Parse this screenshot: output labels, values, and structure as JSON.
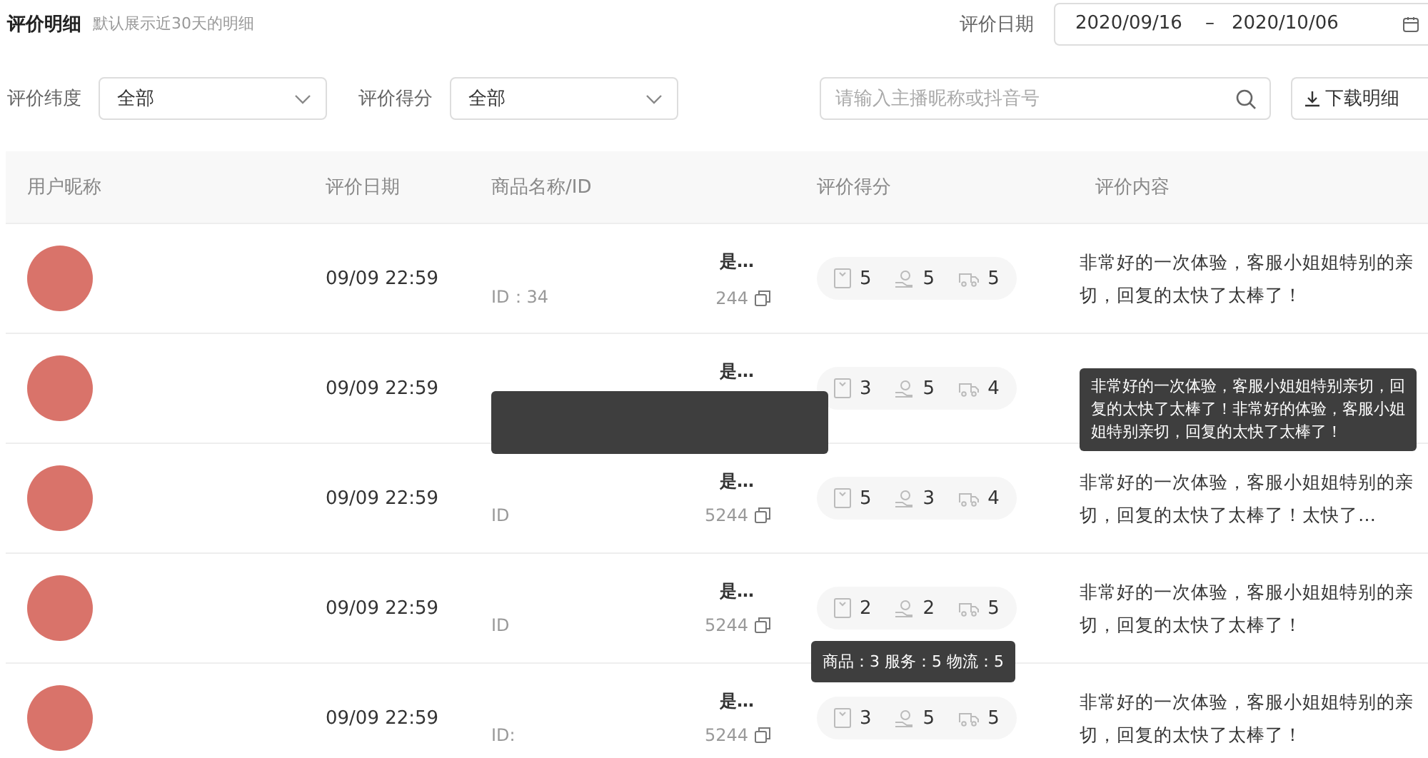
{
  "header": {
    "title": "评价明细",
    "subtitle": "默认展示近30天的明细",
    "date_label": "评价日期",
    "date_start": "2020/09/16",
    "date_separator": "–",
    "date_end": "2020/10/06"
  },
  "filters": [
    {
      "label": "评价纬度",
      "value": "全部"
    },
    {
      "label": "评价得分",
      "value": "全部"
    }
  ],
  "search": {
    "placeholder": "请输入主播昵称或抖音号"
  },
  "download_button": "下载明细",
  "table": {
    "columns": [
      "用户昵称",
      "评价日期",
      "商品名称/ID",
      "评价得分",
      "评价内容"
    ],
    "rows": [
      {
        "date": "09/09 22:59",
        "product": {
          "name": "是…",
          "id_label": "ID：34",
          "id_tail": "244"
        },
        "scores": [
          "5",
          "5",
          "5"
        ],
        "content": "非常好的一次体验，客服小姐姐特别的亲切，回复的太快了太棒了！"
      },
      {
        "date": "09/09 22:59",
        "product": {
          "name": "是…"
        },
        "product_tooltip": true,
        "scores": [
          "3",
          "5",
          "4"
        ],
        "content_tooltip": "非常好的一次体验，客服小姐姐特别亲切，回复的太快了太棒了！非常好的体验，客服小姐姐特别亲切，回复的太快了太棒了！"
      },
      {
        "date": "09/09 22:59",
        "product": {
          "name": "是…",
          "id_label": "ID",
          "id_tail": "5244"
        },
        "scores": [
          "5",
          "3",
          "4"
        ],
        "content": "非常好的一次体验，客服小姐姐特别的亲切，回复的太快了太棒了！太快了…"
      },
      {
        "date": "09/09 22:59",
        "product": {
          "name": "是…",
          "id_label": "ID",
          "id_tail": "5244"
        },
        "scores": [
          "2",
          "2",
          "5"
        ],
        "content": "非常好的一次体验，客服小姐姐特别的亲切，回复的太快了太棒了！"
      },
      {
        "date": "09/09 22:59",
        "product": {
          "name": "是…",
          "id_label": "ID:",
          "id_tail": "5244"
        },
        "scores": [
          "3",
          "5",
          "5"
        ],
        "score_tooltip": "商品：3  服务：5  物流：5",
        "content": "非常好的一次体验，客服小姐姐特别的亲切，回复的太快了太棒了！"
      }
    ]
  }
}
